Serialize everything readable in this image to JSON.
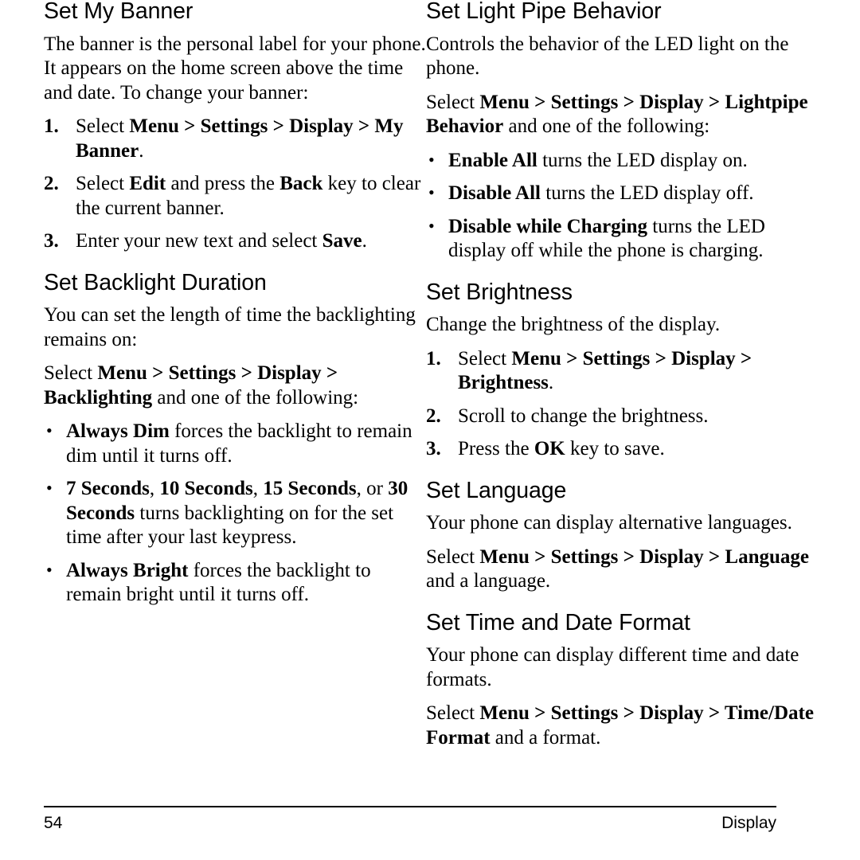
{
  "page": {
    "number": "54",
    "section_label": "Display"
  },
  "left_column": {
    "sections": [
      {
        "title": "Set My Banner",
        "intro": "The banner is the personal label for your phone. It appears on the home screen above the time and date. To change your banner:",
        "steps": [
          {
            "num": "1.",
            "text_parts": [
              {
                "t": "Select ",
                "b": false
              },
              {
                "t": "Menu > Settings > Display > My Banner",
                "b": true
              },
              {
                "t": ".",
                "b": false
              }
            ]
          },
          {
            "num": "2.",
            "text_parts": [
              {
                "t": "Select ",
                "b": false
              },
              {
                "t": "Edit",
                "b": true
              },
              {
                "t": " and press the ",
                "b": false
              },
              {
                "t": "Back",
                "b": true
              },
              {
                "t": "  key to clear the current banner.",
                "b": false
              }
            ]
          },
          {
            "num": "3.",
            "text_parts": [
              {
                "t": "Enter your new text and select ",
                "b": false
              },
              {
                "t": "Save",
                "b": true
              },
              {
                "t": ".",
                "b": false
              }
            ]
          }
        ]
      },
      {
        "title": "Set Backlight Duration",
        "intro": "You can set the length of time the backlighting remains on:",
        "path_parts": [
          {
            "t": "Select ",
            "b": false
          },
          {
            "t": "Menu > Settings > Display > Backlighting",
            "b": true
          },
          {
            "t": " and one of the following:",
            "b": false
          }
        ],
        "bullets": [
          [
            {
              "t": "Always Dim",
              "b": true
            },
            {
              "t": " forces the backlight to remain dim until it turns off.",
              "b": false
            }
          ],
          [
            {
              "t": "7 Seconds",
              "b": true
            },
            {
              "t": ", ",
              "b": false
            },
            {
              "t": "10 Seconds",
              "b": true
            },
            {
              "t": ", ",
              "b": false
            },
            {
              "t": "15 Seconds",
              "b": true
            },
            {
              "t": ", or ",
              "b": false
            },
            {
              "t": "30 Seconds",
              "b": true
            },
            {
              "t": " turns backlighting on for the set time after your last keypress.",
              "b": false
            }
          ],
          [
            {
              "t": "Always Bright",
              "b": true
            },
            {
              "t": " forces the backlight to remain bright until it turns off.",
              "b": false
            }
          ]
        ]
      }
    ]
  },
  "right_column": {
    "sections": [
      {
        "title": "Set Light Pipe Behavior",
        "intro": "Controls the behavior of the LED light on the phone.",
        "path_parts": [
          {
            "t": "Select ",
            "b": false
          },
          {
            "t": "Menu > Settings > Display > Lightpipe Behavior",
            "b": true
          },
          {
            "t": " and one of the following:",
            "b": false
          }
        ],
        "bullets": [
          [
            {
              "t": "Enable All",
              "b": true
            },
            {
              "t": " turns the LED display on.",
              "b": false
            }
          ],
          [
            {
              "t": "Disable All",
              "b": true
            },
            {
              "t": " turns the LED display off.",
              "b": false
            }
          ],
          [
            {
              "t": "Disable while Charging",
              "b": true
            },
            {
              "t": " turns the LED display off while the phone is charging.",
              "b": false
            }
          ]
        ]
      },
      {
        "title": "Set Brightness",
        "intro": "Change the brightness of the display.",
        "steps": [
          {
            "num": "1.",
            "text_parts": [
              {
                "t": "Select ",
                "b": false
              },
              {
                "t": "Menu  > Settings > Display > Brightness",
                "b": true
              },
              {
                "t": ".",
                "b": false
              }
            ]
          },
          {
            "num": "2.",
            "text_parts": [
              {
                "t": "Scroll to change the brightness.",
                "b": false
              }
            ]
          },
          {
            "num": "3.",
            "text_parts": [
              {
                "t": "Press the ",
                "b": false
              },
              {
                "t": "OK",
                "b": true
              },
              {
                "t": " key to save.",
                "b": false
              }
            ]
          }
        ]
      },
      {
        "title": "Set Language",
        "intro": "Your phone can display alternative languages.",
        "path_parts": [
          {
            "t": "Select ",
            "b": false
          },
          {
            "t": "Menu > Settings > Display > Language",
            "b": true
          },
          {
            "t": " and a language.",
            "b": false
          }
        ]
      },
      {
        "title": "Set Time and Date Format",
        "intro": "Your phone can display different time and date formats.",
        "path_parts": [
          {
            "t": "Select ",
            "b": false
          },
          {
            "t": "Menu > Settings > Display > Time/Date Format",
            "b": true
          },
          {
            "t": " and a format.",
            "b": false
          }
        ]
      }
    ]
  },
  "glyphs": {
    "bullet": "•"
  }
}
